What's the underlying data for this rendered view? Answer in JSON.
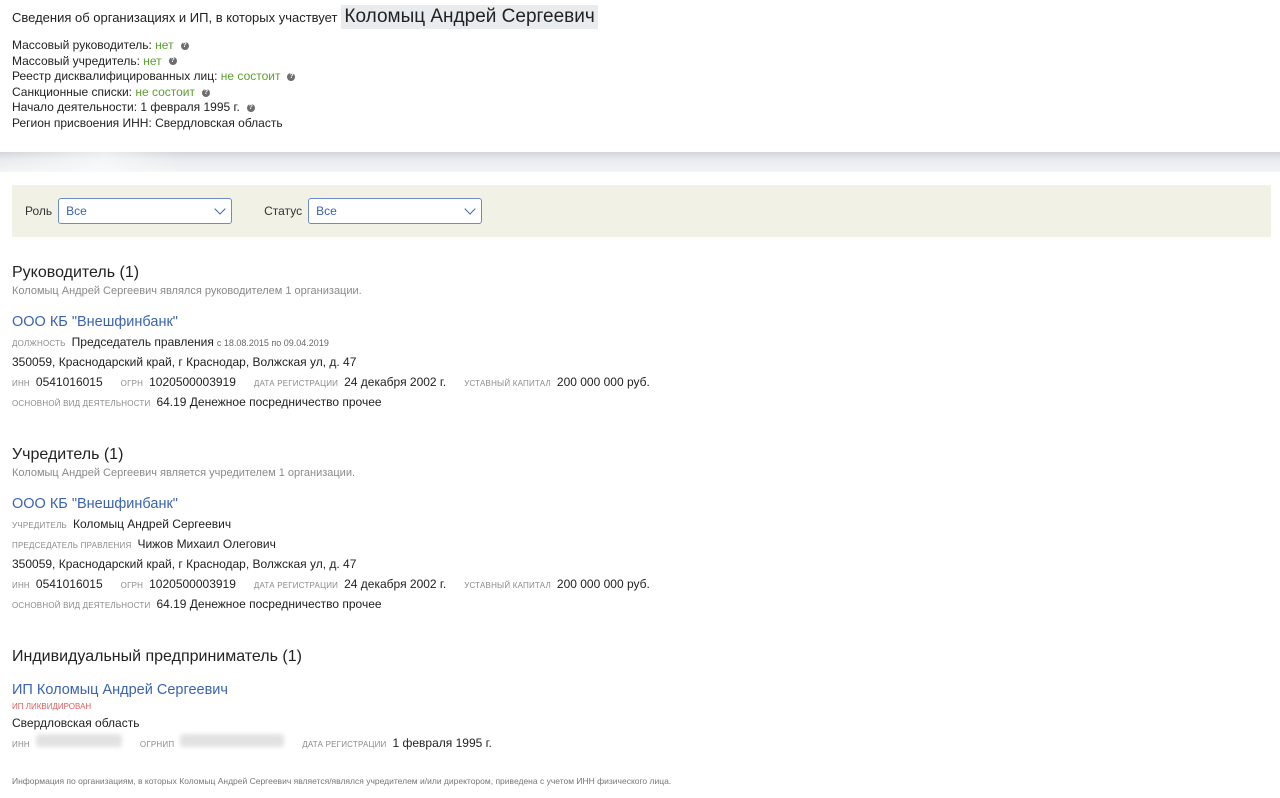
{
  "header": {
    "title_prefix": "Сведения об организациях и ИП, в которых участвует",
    "person_name": "Коломыц Андрей Сергеевич",
    "facts": [
      {
        "label": "Массовый руководитель:",
        "value": "нет",
        "value_style": "green",
        "has_info": true
      },
      {
        "label": "Массовый учредитель:",
        "value": "нет",
        "value_style": "green",
        "has_info": true
      },
      {
        "label": "Реестр дисквалифицированных лиц:",
        "value": "не состоит",
        "value_style": "green",
        "has_info": true
      },
      {
        "label": "Санкционные списки:",
        "value": "не состоит",
        "value_style": "green",
        "has_info": true
      },
      {
        "label": "Начало деятельности:",
        "value": "1 февраля 1995 г.",
        "value_style": "plain",
        "has_info": true
      },
      {
        "label": "Регион присвоения ИНН:",
        "value": "Свердловская область",
        "value_style": "plain",
        "has_info": false
      }
    ]
  },
  "filters": {
    "role_label": "Роль",
    "role_value": "Все",
    "status_label": "Статус",
    "status_value": "Все"
  },
  "sections": {
    "director": {
      "title": "Руководитель (1)",
      "subtitle": "Коломыц Андрей Сергеевич являлся руководителем 1 организации.",
      "org_name": "ООО КБ \"Внешфинбанк\"",
      "position_label": "должность",
      "position_value": "Председатель правления",
      "position_period": "с 18.08.2015 по 09.04.2019",
      "address": "350059, Краснодарский край, г Краснодар, Волжская ул, д. 47",
      "inn_label": "инн",
      "inn": "0541016015",
      "ogrn_label": "огрн",
      "ogrn": "1020500003919",
      "reg_label": "дата регистрации",
      "reg_date": "24 декабря 2002 г.",
      "capital_label": "уставный капитал",
      "capital": "200 000 000 руб.",
      "activity_label": "основной вид деятельности",
      "activity": "64.19 Денежное посредничество прочее"
    },
    "founder": {
      "title": "Учредитель (1)",
      "subtitle": "Коломыц Андрей Сергеевич является учредителем 1 организации.",
      "org_name": "ООО КБ \"Внешфинбанк\"",
      "founder_label": "учредитель",
      "founder_value": "Коломыц Андрей Сергеевич",
      "chair_label": "председатель правления",
      "chair_value": "Чижов Михаил Олегович",
      "address": "350059, Краснодарский край, г Краснодар, Волжская ул, д. 47",
      "inn_label": "инн",
      "inn": "0541016015",
      "ogrn_label": "огрн",
      "ogrn": "1020500003919",
      "reg_label": "дата регистрации",
      "reg_date": "24 декабря 2002 г.",
      "capital_label": "уставный капитал",
      "capital": "200 000 000 руб.",
      "activity_label": "основной вид деятельности",
      "activity": "64.19 Денежное посредничество прочее"
    },
    "entrepreneur": {
      "title": "Индивидуальный предприниматель (1)",
      "name": "ИП Коломыц Андрей Сергеевич",
      "status": "ИП ликвидирован",
      "region": "Свердловская область",
      "inn_label": "инн",
      "ogrnip_label": "огрнип",
      "reg_label": "дата регистрации",
      "reg_date": "1 февраля 1995 г."
    }
  },
  "footnote": "Информация по организациям, в которых Коломыц Андрей Сергеевич является/являлся учредителем и/или директором, приведена с учетом ИНН физического лица.",
  "colors": {
    "link": "#3a63b3",
    "green": "#5a9e2f",
    "filter_bg": "#f1f1e6",
    "liquidated": "#e05c5c"
  },
  "icons": {
    "info": "info-icon",
    "dropdown": "chevron-down-icon"
  }
}
